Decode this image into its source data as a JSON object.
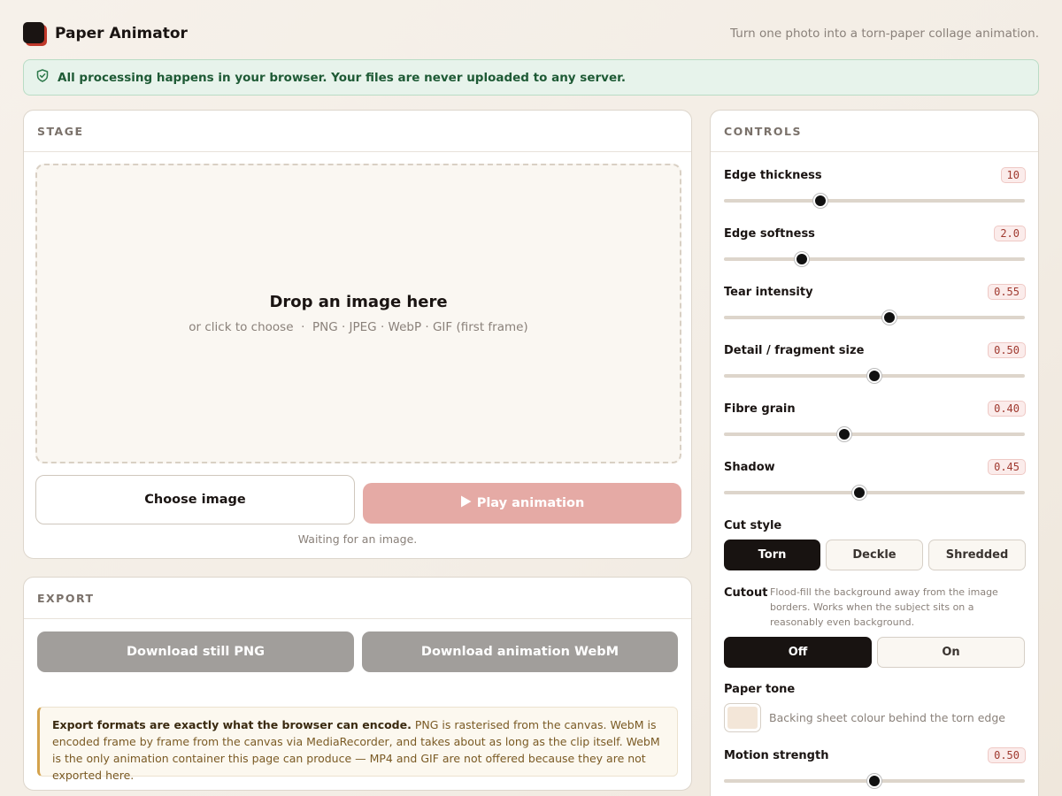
{
  "header": {
    "app_title": "Paper Animator",
    "tagline": "Turn one photo into a torn-paper collage animation."
  },
  "notice": {
    "icon": "shield-check-icon",
    "text": "All processing happens in your browser. Your files are never uploaded to any server."
  },
  "stage": {
    "title": "STAGE",
    "drop_title": "Drop an image here",
    "drop_subtitle": "or click to choose  ·  PNG · JPEG · WebP · GIF (first frame)",
    "choose_label": "Choose image",
    "play_label": "Play animation",
    "play_icon": "play-icon",
    "status": "Waiting for an image."
  },
  "export": {
    "title": "EXPORT",
    "png_label": "Download still PNG",
    "webm_label": "Download animation WebM",
    "info_bold": "Export formats are exactly what the browser can encode.",
    "info_text": " PNG is rasterised from the canvas. WebM is encoded frame by frame from the canvas via MediaRecorder, and takes about as long as the clip itself. WebM is the only animation container this page can produce — MP4 and GIF are not offered because they are not exported here."
  },
  "controls": {
    "title": "CONTROLS",
    "sliders": [
      {
        "label": "Edge thickness",
        "value": "10",
        "fraction": 0.32
      },
      {
        "label": "Edge softness",
        "value": "2.0",
        "fraction": 0.26
      },
      {
        "label": "Tear intensity",
        "value": "0.55",
        "fraction": 0.55
      },
      {
        "label": "Detail / fragment size",
        "value": "0.50",
        "fraction": 0.5
      },
      {
        "label": "Fibre grain",
        "value": "0.40",
        "fraction": 0.4
      },
      {
        "label": "Shadow",
        "value": "0.45",
        "fraction": 0.45
      }
    ],
    "cut_style": {
      "label": "Cut style",
      "options": [
        "Torn",
        "Deckle",
        "Shredded"
      ],
      "selected": "Torn"
    },
    "cutout": {
      "label": "Cutout",
      "description": "Flood-fill the background away from the image borders. Works when the subject sits on a reasonably even background.",
      "options": [
        "Off",
        "On"
      ],
      "selected": "Off"
    },
    "paper_tone": {
      "label": "Paper tone",
      "color": "#f3e6d8",
      "description": "Backing sheet colour behind the torn edge"
    },
    "motion_strength": {
      "label": "Motion strength",
      "value": "0.50",
      "fraction": 0.5
    }
  },
  "colors": {
    "accent": "#c0392b",
    "dark": "#181311",
    "success_bg": "#e7f3eb",
    "disabled": "#a19e9b"
  }
}
